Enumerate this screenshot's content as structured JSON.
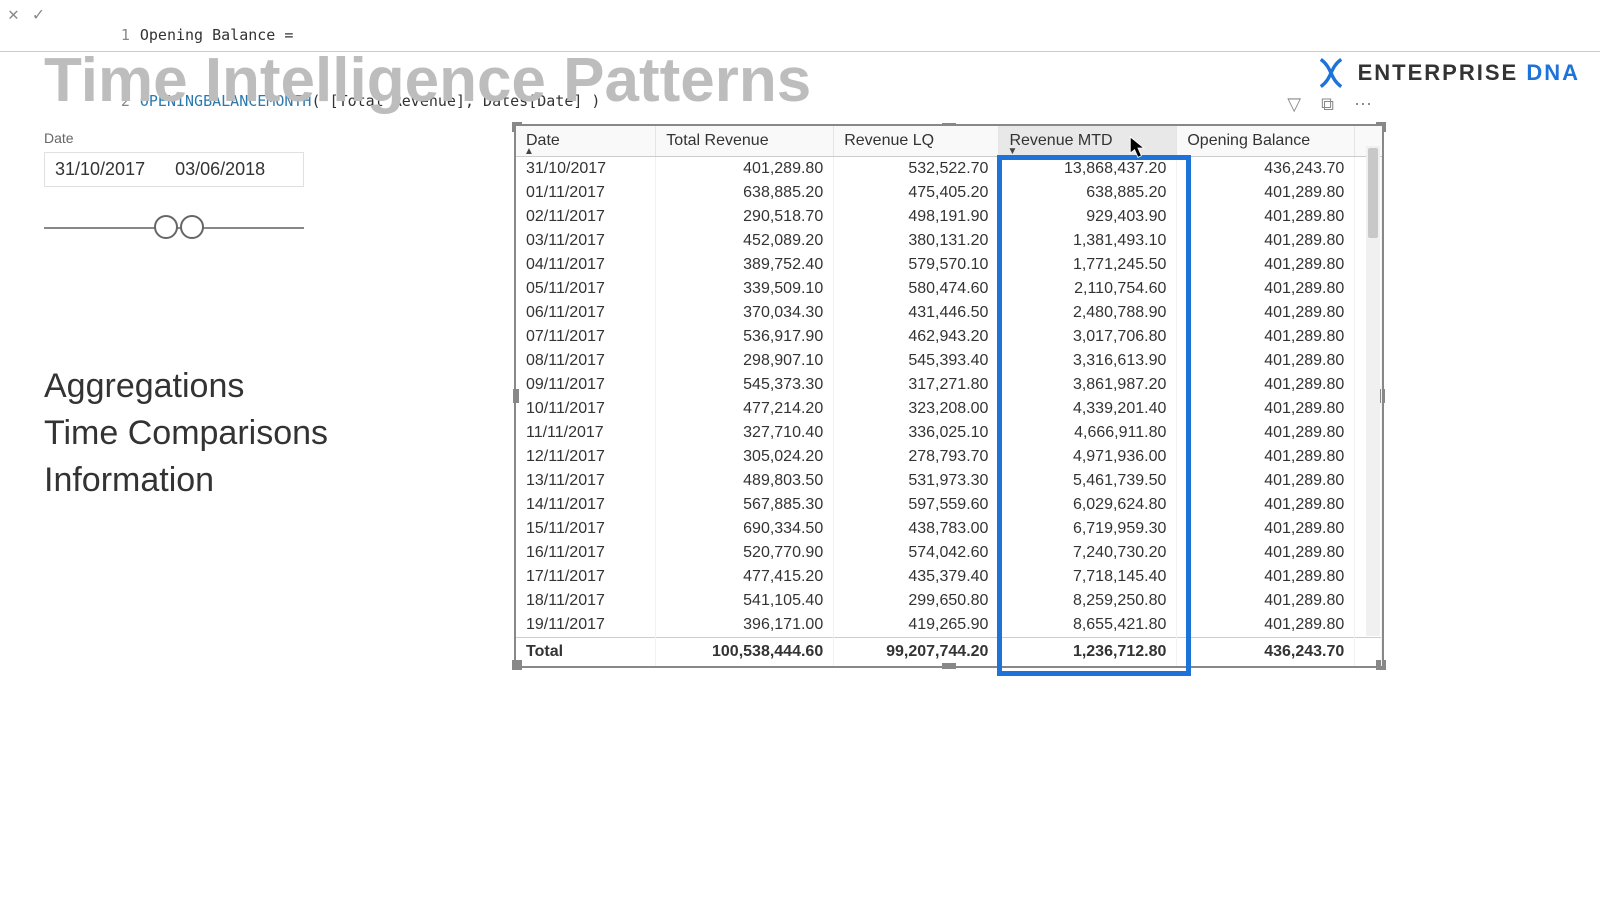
{
  "formula": {
    "line1_prefix": "Opening Balance ",
    "line1_eq": "=",
    "line2_fn": "OPENINGBALANCEMONTH",
    "line2_args": "( [Total Revenue], Dates[Date] )"
  },
  "pageTitle": "Time Intelligence Patterns",
  "brand": {
    "word1": "ENTERPRISE",
    "word2": "DNA"
  },
  "slicer": {
    "label": "Date",
    "from": "31/10/2017",
    "to": "03/06/2018"
  },
  "nav": {
    "aggregations": "Aggregations",
    "timeComparisons": "Time Comparisons",
    "information": "Information"
  },
  "table": {
    "headers": {
      "date": "Date",
      "totalRevenue": "Total Revenue",
      "revenueLQ": "Revenue LQ",
      "revenueMTD": "Revenue MTD",
      "openingBalance": "Opening Balance"
    },
    "rows": [
      {
        "date": "31/10/2017",
        "tr": "401,289.80",
        "lq": "532,522.70",
        "mtd": "13,868,437.20",
        "ob": "436,243.70"
      },
      {
        "date": "01/11/2017",
        "tr": "638,885.20",
        "lq": "475,405.20",
        "mtd": "638,885.20",
        "ob": "401,289.80"
      },
      {
        "date": "02/11/2017",
        "tr": "290,518.70",
        "lq": "498,191.90",
        "mtd": "929,403.90",
        "ob": "401,289.80"
      },
      {
        "date": "03/11/2017",
        "tr": "452,089.20",
        "lq": "380,131.20",
        "mtd": "1,381,493.10",
        "ob": "401,289.80"
      },
      {
        "date": "04/11/2017",
        "tr": "389,752.40",
        "lq": "579,570.10",
        "mtd": "1,771,245.50",
        "ob": "401,289.80"
      },
      {
        "date": "05/11/2017",
        "tr": "339,509.10",
        "lq": "580,474.60",
        "mtd": "2,110,754.60",
        "ob": "401,289.80"
      },
      {
        "date": "06/11/2017",
        "tr": "370,034.30",
        "lq": "431,446.50",
        "mtd": "2,480,788.90",
        "ob": "401,289.80"
      },
      {
        "date": "07/11/2017",
        "tr": "536,917.90",
        "lq": "462,943.20",
        "mtd": "3,017,706.80",
        "ob": "401,289.80"
      },
      {
        "date": "08/11/2017",
        "tr": "298,907.10",
        "lq": "545,393.40",
        "mtd": "3,316,613.90",
        "ob": "401,289.80"
      },
      {
        "date": "09/11/2017",
        "tr": "545,373.30",
        "lq": "317,271.80",
        "mtd": "3,861,987.20",
        "ob": "401,289.80"
      },
      {
        "date": "10/11/2017",
        "tr": "477,214.20",
        "lq": "323,208.00",
        "mtd": "4,339,201.40",
        "ob": "401,289.80"
      },
      {
        "date": "11/11/2017",
        "tr": "327,710.40",
        "lq": "336,025.10",
        "mtd": "4,666,911.80",
        "ob": "401,289.80"
      },
      {
        "date": "12/11/2017",
        "tr": "305,024.20",
        "lq": "278,793.70",
        "mtd": "4,971,936.00",
        "ob": "401,289.80"
      },
      {
        "date": "13/11/2017",
        "tr": "489,803.50",
        "lq": "531,973.30",
        "mtd": "5,461,739.50",
        "ob": "401,289.80"
      },
      {
        "date": "14/11/2017",
        "tr": "567,885.30",
        "lq": "597,559.60",
        "mtd": "6,029,624.80",
        "ob": "401,289.80"
      },
      {
        "date": "15/11/2017",
        "tr": "690,334.50",
        "lq": "438,783.00",
        "mtd": "6,719,959.30",
        "ob": "401,289.80"
      },
      {
        "date": "16/11/2017",
        "tr": "520,770.90",
        "lq": "574,042.60",
        "mtd": "7,240,730.20",
        "ob": "401,289.80"
      },
      {
        "date": "17/11/2017",
        "tr": "477,415.20",
        "lq": "435,379.40",
        "mtd": "7,718,145.40",
        "ob": "401,289.80"
      },
      {
        "date": "18/11/2017",
        "tr": "541,105.40",
        "lq": "299,650.80",
        "mtd": "8,259,250.80",
        "ob": "401,289.80"
      },
      {
        "date": "19/11/2017",
        "tr": "396,171.00",
        "lq": "419,265.90",
        "mtd": "8,655,421.80",
        "ob": "401,289.80"
      }
    ],
    "total": {
      "label": "Total",
      "tr": "100,538,444.60",
      "lq": "99,207,744.20",
      "mtd": "1,236,712.80",
      "ob": "436,243.70"
    }
  }
}
